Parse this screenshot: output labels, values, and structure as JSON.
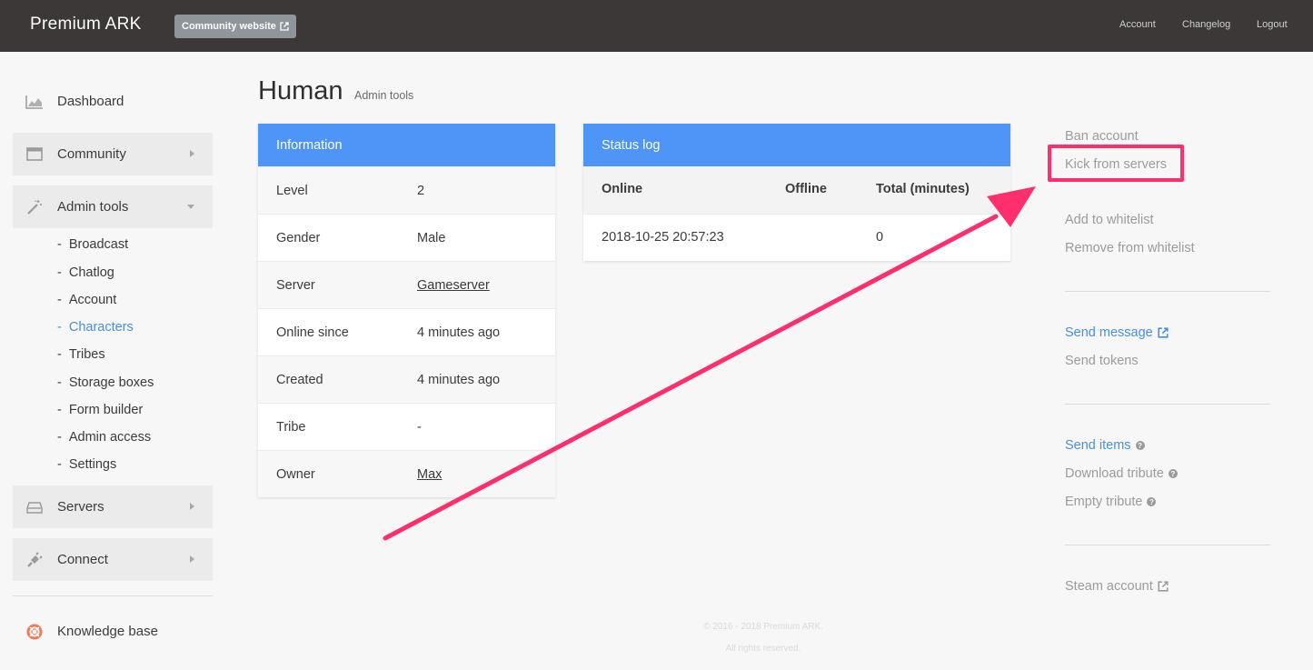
{
  "topbar": {
    "brand": "Premium ARK",
    "community_label": "Community website",
    "nav": [
      "Account",
      "Changelog",
      "Logout"
    ]
  },
  "sidebar": {
    "items": [
      {
        "label": "Dashboard",
        "icon": "area-chart-icon"
      },
      {
        "label": "Community",
        "icon": "window-icon"
      },
      {
        "label": "Admin tools",
        "icon": "magic-wand-icon"
      },
      {
        "label": "Servers",
        "icon": "hard-drive-icon"
      },
      {
        "label": "Connect",
        "icon": "plug-icon"
      },
      {
        "label": "Knowledge base",
        "icon": "lifebuoy-icon"
      }
    ],
    "sub_items": [
      "Broadcast",
      "Chatlog",
      "Account",
      "Characters",
      "Tribes",
      "Storage boxes",
      "Form builder",
      "Admin access",
      "Settings"
    ],
    "active_sub": "Characters"
  },
  "header": {
    "title": "Human",
    "subtitle": "Admin tools"
  },
  "information": {
    "heading": "Information",
    "rows": [
      {
        "key": "Level",
        "value": "2"
      },
      {
        "key": "Gender",
        "value": "Male"
      },
      {
        "key": "Server",
        "value": "Gameserver"
      },
      {
        "key": "Online since",
        "value": "4 minutes ago"
      },
      {
        "key": "Created",
        "value": "4 minutes ago"
      },
      {
        "key": "Tribe",
        "value": "-"
      },
      {
        "key": "Owner",
        "value": "Max"
      }
    ]
  },
  "status_log": {
    "heading": "Status log",
    "columns": [
      "Online",
      "Offline",
      "Total (minutes)"
    ],
    "rows": [
      {
        "online": "2018-10-25 20:57:23",
        "offline": "",
        "total": "0"
      }
    ]
  },
  "actions": {
    "ban": "Ban account",
    "kick": "Kick from servers",
    "add_whitelist": "Add to whitelist",
    "remove_whitelist": "Remove from whitelist",
    "send_message": "Send message",
    "send_tokens": "Send tokens",
    "send_items": "Send items",
    "download_tribute": "Download tribute",
    "empty_tribute": "Empty tribute",
    "steam_account": "Steam account"
  },
  "footer": {
    "copyright": "© 2016 - 2018 Premium ARK.",
    "rights": "All rights reserved."
  },
  "colors": {
    "topbar": "#3d3838",
    "panel_header": "#4f95f7",
    "link_blue": "#4a90d9",
    "annotation": "#ff2f6e"
  }
}
